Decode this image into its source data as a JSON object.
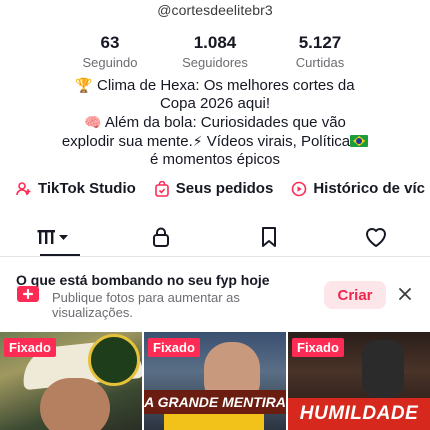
{
  "profile": {
    "handle": "@cortesdeelitebr3",
    "stats": [
      {
        "value": "63",
        "label": "Seguindo"
      },
      {
        "value": "1.084",
        "label": "Seguidores"
      },
      {
        "value": "5.127",
        "label": "Curtidas"
      }
    ],
    "bio": {
      "line1_emoji": "🏆",
      "line1": "Clima de Hexa: Os melhores cortes da",
      "line2": "Copa 2026 aqui!",
      "line3_emoji": "🧠",
      "line3": "Além da bola: Curiosidades que vão",
      "line4_a": "explodir sua mente.",
      "line4_emoji": "⚡",
      "line4_b": "Vídeos virais, Política",
      "line4_flag": "brazil-flag",
      "line5": "é momentos épicos"
    }
  },
  "shortcuts": [
    {
      "label": "TikTok Studio",
      "icon": "person-plus-icon"
    },
    {
      "label": "Seus pedidos",
      "icon": "bag-check-icon"
    },
    {
      "label": "Histórico de víc",
      "icon": "play-circle-icon"
    }
  ],
  "tabs": [
    {
      "name": "videos-grid",
      "icon": "grid-icon",
      "active": true
    },
    {
      "name": "private",
      "icon": "lock-icon"
    },
    {
      "name": "saved",
      "icon": "bookmark-icon"
    },
    {
      "name": "liked",
      "icon": "heart-icon"
    }
  ],
  "fyp_prompt": {
    "title": "O que está bombando no seu fyp hoje",
    "description": "Publique fotos para aumentar as visualizações.",
    "action": "Criar",
    "icon": "add-photo-icon"
  },
  "videos": [
    {
      "pinned_label": "Fixado",
      "overlay": ""
    },
    {
      "pinned_label": "Fixado",
      "overlay": "A GRANDE MENTIRA"
    },
    {
      "pinned_label": "Fixado",
      "overlay": "HUMILDADE"
    }
  ],
  "colors": {
    "accent": "#fe2c55",
    "criar_bg": "#fde6ea",
    "text_primary": "#161823",
    "text_secondary": "#6b6d72"
  }
}
